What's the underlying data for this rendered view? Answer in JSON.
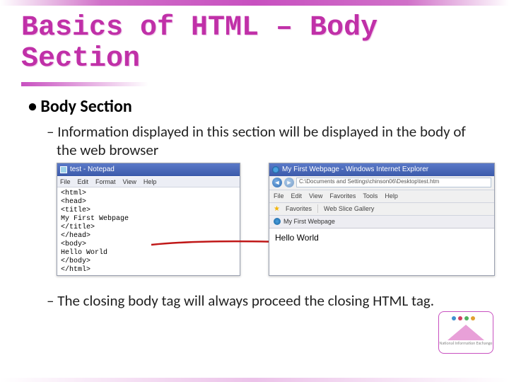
{
  "title": "Basics of HTML – Body Section",
  "bullet_l1": "Body Section",
  "bullet_l2_a": "Information displayed in this section will be displayed in the body of the web browser",
  "bullet_l2_b": "The closing body tag will always proceed the closing HTML tag.",
  "notepad": {
    "title": "test - Notepad",
    "menu": [
      "File",
      "Edit",
      "Format",
      "View",
      "Help"
    ],
    "content": "<html>\n<head>\n<title>\nMy First Webpage\n</title>\n</head>\n<body>\nHello World\n</body>\n</html>"
  },
  "ie": {
    "title": "My First Webpage - Windows Internet Explorer",
    "address": "C:\\Documents and Settings\\chinson06\\Desktop\\test.htm",
    "toolbar": [
      "File",
      "Edit",
      "View",
      "Favorites",
      "Tools",
      "Help"
    ],
    "favorites_label": "Favorites",
    "fav_item": "Web Slice Gallery",
    "tab_label": "My First Webpage",
    "page_text": "Hello World"
  },
  "corner_caption": "National Information Exchange"
}
